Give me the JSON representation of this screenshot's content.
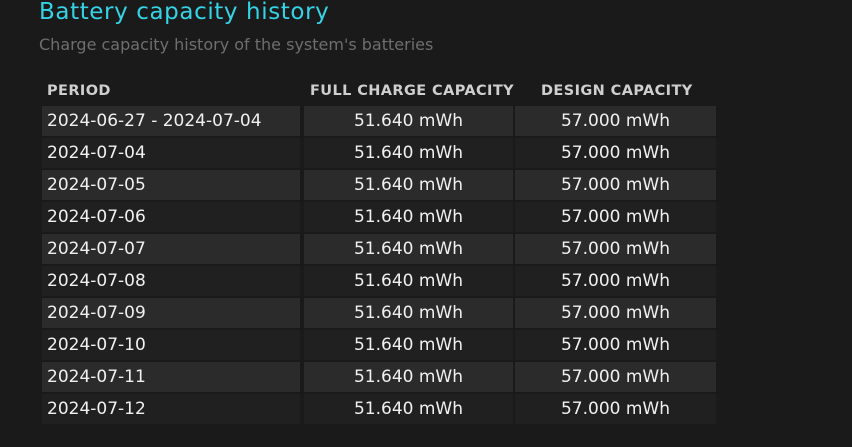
{
  "header": {
    "title": "Battery capacity history",
    "subtitle": "Charge capacity history of the system's batteries"
  },
  "table": {
    "columns": [
      "PERIOD",
      "FULL CHARGE CAPACITY",
      "DESIGN CAPACITY"
    ],
    "rows": [
      {
        "period": "2024-06-27 - 2024-07-04",
        "full": "51.640 mWh",
        "design": "57.000 mWh"
      },
      {
        "period": "2024-07-04",
        "full": "51.640 mWh",
        "design": "57.000 mWh"
      },
      {
        "period": "2024-07-05",
        "full": "51.640 mWh",
        "design": "57.000 mWh"
      },
      {
        "period": "2024-07-06",
        "full": "51.640 mWh",
        "design": "57.000 mWh"
      },
      {
        "period": "2024-07-07",
        "full": "51.640 mWh",
        "design": "57.000 mWh"
      },
      {
        "period": "2024-07-08",
        "full": "51.640 mWh",
        "design": "57.000 mWh"
      },
      {
        "period": "2024-07-09",
        "full": "51.640 mWh",
        "design": "57.000 mWh"
      },
      {
        "period": "2024-07-10",
        "full": "51.640 mWh",
        "design": "57.000 mWh"
      },
      {
        "period": "2024-07-11",
        "full": "51.640 mWh",
        "design": "57.000 mWh"
      },
      {
        "period": "2024-07-12",
        "full": "51.640 mWh",
        "design": "57.000 mWh"
      }
    ]
  },
  "colors": {
    "title": "#35d3e6",
    "subtitle": "#6e6e6e",
    "background": "#1a1a1a",
    "row_odd": "#2b2b2b",
    "row_even": "#202020"
  }
}
